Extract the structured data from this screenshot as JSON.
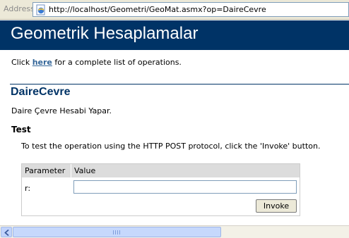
{
  "address_bar": {
    "label": "Address",
    "url": "http://localhost/Geometri/GeoMat.asmx?op=DaireCevre"
  },
  "page": {
    "title": "Geometrik Hesaplamalar",
    "intro_prefix": "Click ",
    "intro_link": "here",
    "intro_suffix": " for a complete list of operations."
  },
  "operation": {
    "name": "DaireCevre",
    "description": "Daire Çevre Hesabi Yapar."
  },
  "test": {
    "heading": "Test",
    "instructions": "To test the operation using the HTTP POST protocol, click the 'Invoke' button."
  },
  "form": {
    "col_parameter": "Parameter",
    "col_value": "Value",
    "params": [
      {
        "label": "r:",
        "value": ""
      }
    ],
    "invoke_label": "Invoke"
  },
  "colors": {
    "banner": "#003366",
    "link": "#336699",
    "heading": "#003366"
  },
  "icons": {
    "address_page": "ie-page-icon",
    "scroll_left": "arrow-left-icon"
  }
}
